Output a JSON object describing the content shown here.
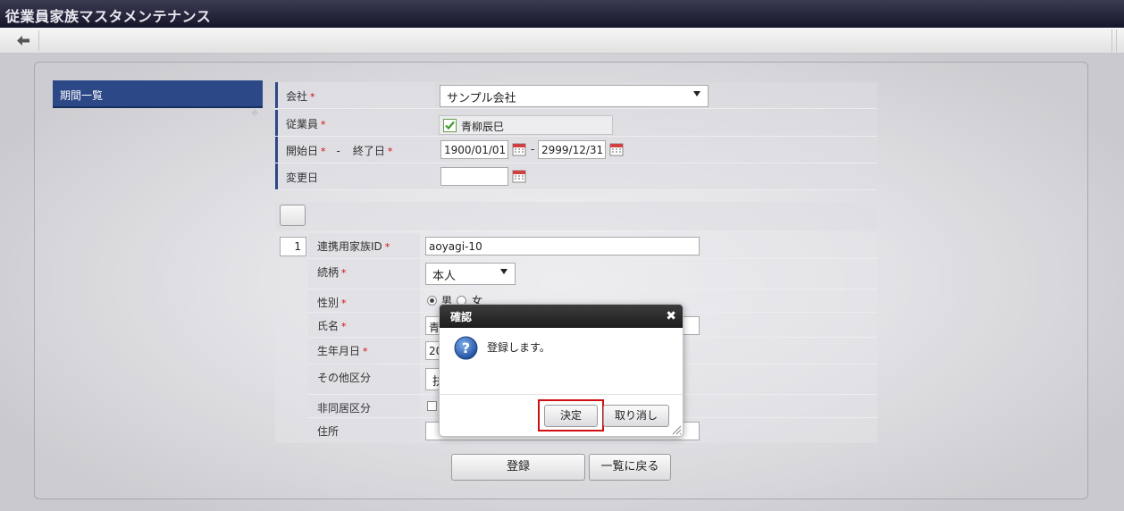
{
  "window": {
    "title": "従業員家族マスタメンテナンス"
  },
  "sidebar": {
    "items": [
      {
        "label": "期間一覧"
      }
    ]
  },
  "form": {
    "company": {
      "label": "会社",
      "required": "*",
      "value": "サンプル会社"
    },
    "employee": {
      "label": "従業員",
      "required": "*",
      "value": "青柳辰巳"
    },
    "period": {
      "start_label": "開始日",
      "required": "*",
      "separator": "-",
      "end_label": "終了日",
      "end_required": "*",
      "start_value": "1900/01/01",
      "range_separator": "-",
      "end_value": "2999/12/31"
    },
    "change_date": {
      "label": "変更日",
      "value": ""
    }
  },
  "family": {
    "index": "1",
    "fields": {
      "link_id": {
        "label": "連携用家族ID",
        "required": "*",
        "value": "aoyagi-10"
      },
      "relation": {
        "label": "続柄",
        "required": "*",
        "value": "本人"
      },
      "gender": {
        "label": "性別",
        "required": "*",
        "male": "男",
        "female": "女",
        "selected": "男"
      },
      "name": {
        "label": "氏名",
        "required": "*",
        "value_partial": "青"
      },
      "birthdate": {
        "label": "生年月日",
        "required": "*",
        "value_partial": "20"
      },
      "other": {
        "label": "その他区分",
        "value_partial": "扶"
      },
      "non_cohabiting": {
        "label": "非同居区分"
      },
      "address": {
        "label": "住所"
      }
    }
  },
  "actions": {
    "register": "登録",
    "back_to_list": "一覧に戻る"
  },
  "dialog": {
    "title": "確認",
    "message": "登録します。",
    "ok": "決定",
    "cancel": "取り消し",
    "close_glyph": "✖"
  },
  "colors": {
    "accent": "#2c4887",
    "titlebar": "#1c1c30",
    "highlight": "#d01010",
    "required": "#d01010"
  }
}
